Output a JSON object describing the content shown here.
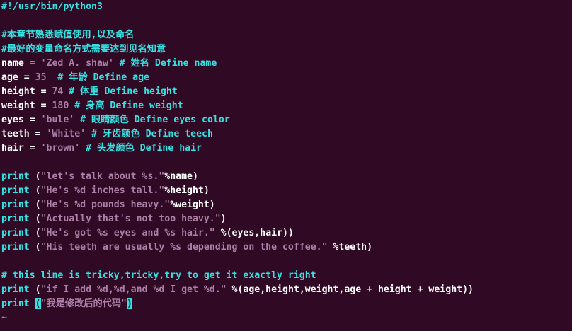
{
  "colors": {
    "background": "#300a24",
    "comment": "#34e2e2",
    "string": "#ad7fa8",
    "keyword": "#34e2e2",
    "text": "#ffffff",
    "tilde": "#729fcf"
  },
  "lines": {
    "l1": "#!/usr/bin/python3",
    "l3": "#本章节熟悉赋值使用,以及命名",
    "l4": "#最好的变量命名方式需要达到见名知意",
    "l5_a": "name = ",
    "l5_b": "'Zed A. shaw'",
    "l5_c": " # 姓名 Define name",
    "l6_a": "age = ",
    "l6_b": "35",
    "l6_c": "  # 年龄 Define age",
    "l7_a": "height = ",
    "l7_b": "74",
    "l7_c": " # 体重 Define height",
    "l8_a": "weight = ",
    "l8_b": "180",
    "l8_c": " # 身高 Define weight",
    "l9_a": "eyes = ",
    "l9_b": "'bule'",
    "l9_c": " # 眼睛颜色 Define eyes color",
    "l10_a": "teeth = ",
    "l10_b": "'White'",
    "l10_c": " # 牙齿颜色 Define teech",
    "l11_a": "hair = ",
    "l11_b": "'brown'",
    "l11_c": " # 头发颜色 Define hair",
    "l13_kw": "print",
    "l13_a": " (",
    "l13_b": "\"let's talk about %s.\"",
    "l13_c": "%name)",
    "l14_kw": "print",
    "l14_a": " (",
    "l14_b": "\"He's %d inches tall.\"",
    "l14_c": "%height)",
    "l15_kw": "print",
    "l15_a": " (",
    "l15_b": "\"He's %d pounds heavy.\"",
    "l15_c": "%weight)",
    "l16_kw": "print",
    "l16_a": " (",
    "l16_b": "\"Actually that's not too heavy.\"",
    "l16_c": ")",
    "l17_kw": "print",
    "l17_a": " (",
    "l17_b": "\"He's got %s eyes and %s hair.\"",
    "l17_c": " %(eyes,hair))",
    "l18_kw": "print",
    "l18_a": " (",
    "l18_b": "\"His teeth are usually %s depending on the coffee.\"",
    "l18_c": " %teeth)",
    "l20": "# this line is tricky,tricky,try to get it exactly right",
    "l21_kw": "print",
    "l21_a": " (",
    "l21_b": "\"if I add %d,%d,and %d I get %d.\"",
    "l21_c": " %(age,height,weight,age + height + weight))",
    "l22_kw": "print",
    "l22_sp": " ",
    "l22_cursor": "(",
    "l22_b": "\"我是修改后的代码\"",
    "l22_cursor2": ")",
    "l23": "~"
  }
}
